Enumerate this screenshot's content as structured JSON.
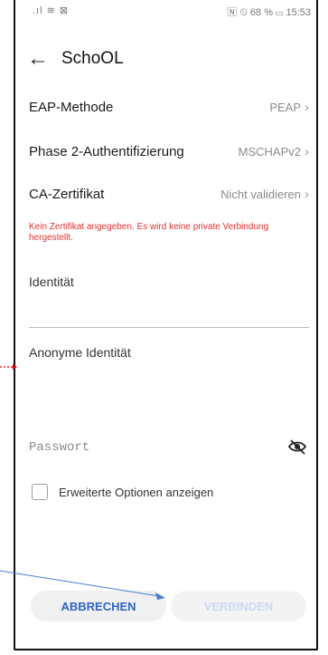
{
  "status_bar": {
    "left": ".ıl ≋ ⊠",
    "right": "🄽 ⏲ 68 % ▭ 15:53"
  },
  "header": {
    "title": "SchoOL"
  },
  "settings": [
    {
      "label": "EAP-Methode",
      "value": "PEAP"
    },
    {
      "label": "Phase 2-Authentifizierung",
      "value": "MSCHAPv2"
    },
    {
      "label": "CA-Zertifikat",
      "value": "Nicht validieren"
    }
  ],
  "warning": "Kein Zertifikat angegeben. Es wird keine private Verbindung hergestellt.",
  "fields": {
    "identity_label": "Identität",
    "anon_identity_label": "Anonyme Identität",
    "password_placeholder": "Passwort"
  },
  "advanced_options_label": "Erweiterte Optionen anzeigen",
  "buttons": {
    "cancel": "ABBRECHEN",
    "connect": "VERBINDEN"
  },
  "colors": {
    "warning": "#e3322f",
    "accent": "#2f64c7",
    "annotation_red": "#e00000",
    "annotation_blue": "#4a7fd0"
  }
}
